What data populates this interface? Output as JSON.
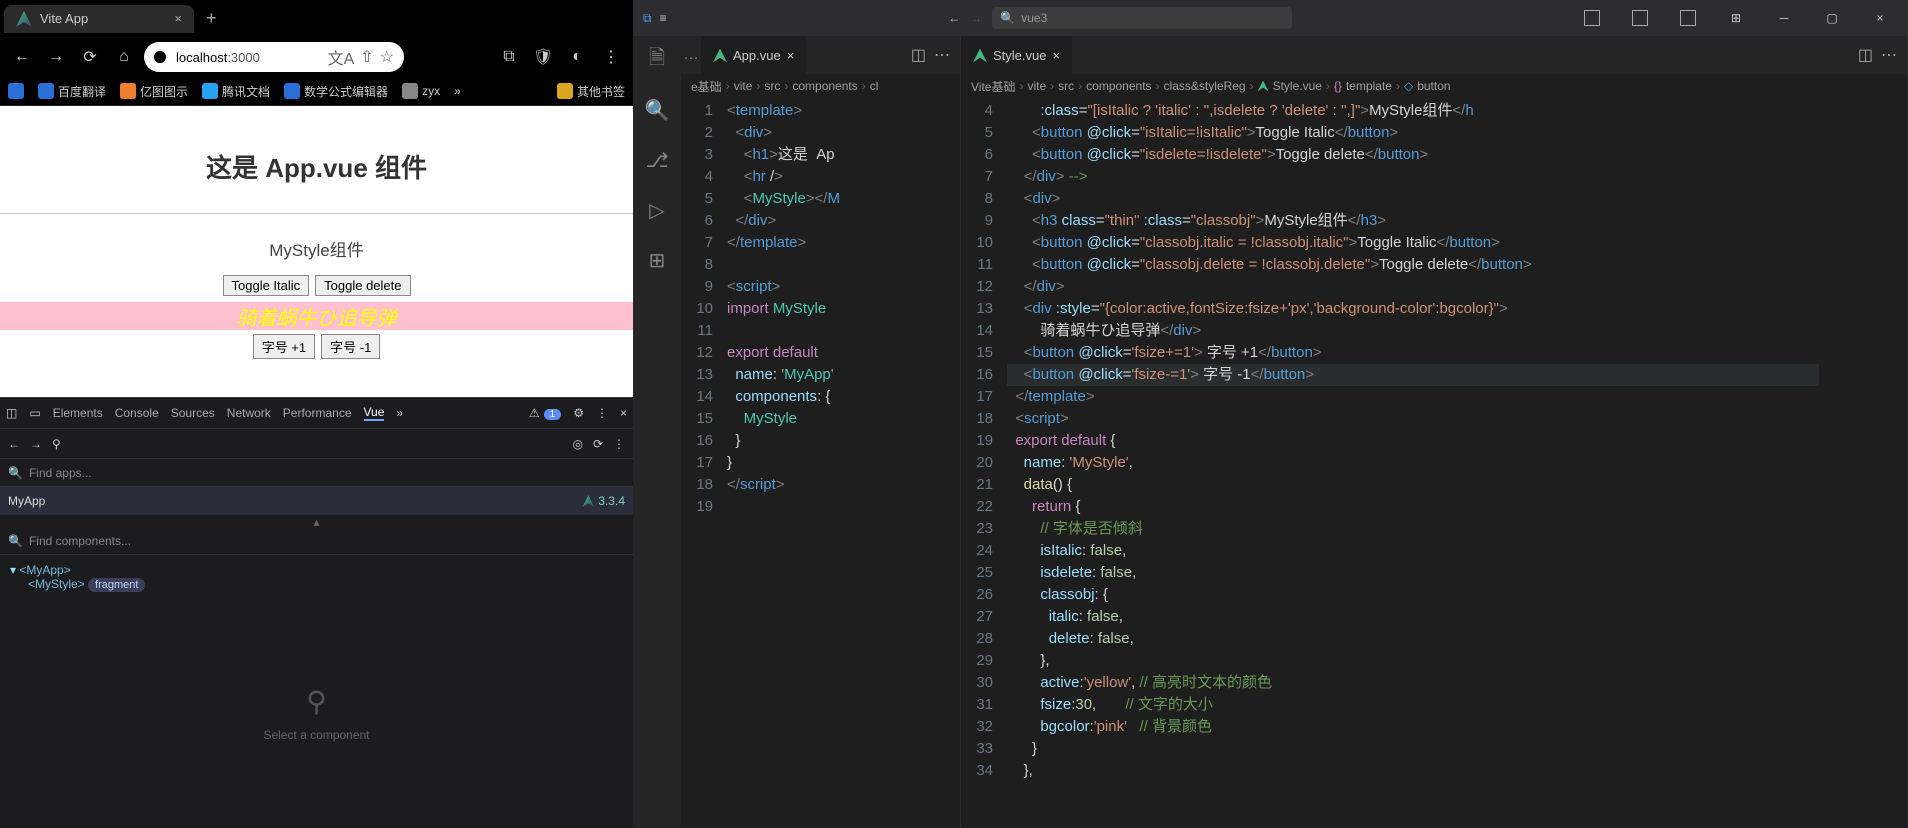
{
  "browser": {
    "tab_title": "Vite App",
    "url_host": "localhost",
    "url_port": ":3000",
    "bookmarks": [
      {
        "label": "百度翻译",
        "color": "#2a6fd6"
      },
      {
        "label": "亿图图示",
        "color": "#f08030"
      },
      {
        "label": "腾讯文档",
        "color": "#2aa0f0"
      },
      {
        "label": "数学公式编辑器",
        "color": "#2a6fd6"
      },
      {
        "label": "zyx",
        "color": "#888"
      },
      {
        "label": "»",
        "color": "transparent"
      },
      {
        "label": "其他书签",
        "color": "#d9a520"
      }
    ]
  },
  "page_content": {
    "h1": "这是 App.vue 组件",
    "subtitle": "MyStyle组件",
    "buttons_row1": [
      "Toggle Italic",
      "Toggle delete"
    ],
    "pink_text": "骑着蜗牛ひ追导弹",
    "buttons_row2": [
      "字号 +1",
      "字号 -1"
    ]
  },
  "devtools": {
    "tabs": [
      "Elements",
      "Console",
      "Sources",
      "Network",
      "Performance",
      "Vue"
    ],
    "active_tab": "Vue",
    "warn_count": "1",
    "search1": "Find apps...",
    "app_row": "MyApp",
    "vue_version": "3.3.4",
    "search2": "Find components...",
    "tree": {
      "root": "<MyApp>",
      "child": "<MyStyle>",
      "frag": "fragment"
    },
    "placeholder": "Select a component"
  },
  "vscode": {
    "command_center": "vue3",
    "tabs_left": {
      "name": "App.vue"
    },
    "tabs_right": {
      "name": "Style.vue"
    },
    "breadcrumb_left": [
      "e基础",
      "vite",
      "src",
      "components",
      "cl"
    ],
    "breadcrumb_right": [
      "Vite基础",
      "vite",
      "src",
      "components",
      "class&styleReg",
      "Style.vue",
      "template",
      "button"
    ],
    "gutter_left": [
      "1",
      "2",
      "3",
      "4",
      "5",
      "6",
      "7",
      "8",
      "9",
      "10",
      "11",
      "12",
      "13",
      "14",
      "15",
      "16",
      "17",
      "18",
      "19"
    ],
    "gutter_right": [
      "4",
      "5",
      "6",
      "7",
      "8",
      "9",
      "10",
      "11",
      "12",
      "13",
      "14",
      "15",
      "16",
      "17",
      "18",
      "19",
      "20",
      "21",
      "22",
      "23",
      "24",
      "25",
      "26",
      "27",
      "28",
      "29",
      "30",
      "31",
      "32",
      "33",
      "34"
    ],
    "code_left": [
      "<template>",
      "  <div>",
      "    <h1>这是  Ap",
      "    <hr />",
      "    <MyStyle></M",
      "  </div>",
      "</template>",
      "",
      "<script>",
      "import MyStyle ",
      "",
      "export default ",
      "  name: 'MyApp'",
      "  components: {",
      "    MyStyle",
      "  }",
      "}",
      "</script>",
      ""
    ],
    "code_right_raw": [
      {
        "indent": 8,
        "html": "<span class='t-attr'>:class</span>=<span class='t-str'>\"[isItalic ? 'italic' : '',isdelete ? 'delete' : '',]\"</span><span class='t-tag'>&gt;</span>MyStyle组件<span class='t-tag'>&lt;/</span><span class='t-name'>h</span>"
      },
      {
        "indent": 6,
        "html": "<span class='t-tag'>&lt;</span><span class='t-name'>button</span> <span class='t-attr'>@click</span>=<span class='t-str'>\"isItalic=!isItalic\"</span><span class='t-tag'>&gt;</span>Toggle Italic<span class='t-tag'>&lt;/</span><span class='t-name'>button</span><span class='t-tag'>&gt;</span>"
      },
      {
        "indent": 6,
        "html": "<span class='t-tag'>&lt;</span><span class='t-name'>button</span> <span class='t-attr'>@click</span>=<span class='t-str'>\"isdelete=!isdelete\"</span><span class='t-tag'>&gt;</span>Toggle delete<span class='t-tag'>&lt;/</span><span class='t-name'>button</span><span class='t-tag'>&gt;</span>"
      },
      {
        "indent": 4,
        "html": "<span class='t-tag'>&lt;/</span><span class='t-name'>div</span><span class='t-tag'>&gt;</span> <span class='t-cm'>--&gt;</span>"
      },
      {
        "indent": 4,
        "html": "<span class='t-tag'>&lt;</span><span class='t-name'>div</span><span class='t-tag'>&gt;</span>"
      },
      {
        "indent": 6,
        "html": "<span class='t-tag'>&lt;</span><span class='t-name'>h3</span> <span class='t-attr'>class</span>=<span class='t-str'>\"thin\"</span> <span class='t-attr'>:class</span>=<span class='t-str'>\"classobj\"</span><span class='t-tag'>&gt;</span>MyStyle组件<span class='t-tag'>&lt;/</span><span class='t-name'>h3</span><span class='t-tag'>&gt;</span>"
      },
      {
        "indent": 6,
        "html": "<span class='t-tag'>&lt;</span><span class='t-name'>button</span> <span class='t-attr'>@click</span>=<span class='t-str'>\"classobj.italic = !classobj.italic\"</span><span class='t-tag'>&gt;</span>Toggle Italic<span class='t-tag'>&lt;/</span><span class='t-name'>button</span><span class='t-tag'>&gt;</span>"
      },
      {
        "indent": 6,
        "html": "<span class='t-tag'>&lt;</span><span class='t-name'>button</span> <span class='t-attr'>@click</span>=<span class='t-str'>\"classobj.delete = !classobj.delete\"</span><span class='t-tag'>&gt;</span>Toggle delete<span class='t-tag'>&lt;/</span><span class='t-name'>button</span><span class='t-tag'>&gt;</span>"
      },
      {
        "indent": 4,
        "html": "<span class='t-tag'>&lt;/</span><span class='t-name'>div</span><span class='t-tag'>&gt;</span>"
      },
      {
        "indent": 4,
        "html": "<span class='t-tag'>&lt;</span><span class='t-name'>div</span> <span class='t-attr'>:style</span>=<span class='t-str'>\"{color:active,fontSize:fsize+'px','background-color':bgcolor}\"</span><span class='t-tag'>&gt;</span>"
      },
      {
        "indent": 8,
        "html": "骑着蜗牛ひ追导弹<span class='t-tag'>&lt;/</span><span class='t-name'>div</span><span class='t-tag'>&gt;</span>"
      },
      {
        "indent": 4,
        "html": "<span class='t-tag'>&lt;</span><span class='t-name'>button</span> <span class='t-attr'>@click</span>=<span class='t-str'>'fsize+=1'</span><span class='t-tag'>&gt;</span> 字号 +1<span class='t-tag'>&lt;/</span><span class='t-name'>button</span><span class='t-tag'>&gt;</span>"
      },
      {
        "indent": 4,
        "html": "<span class='t-tag'>&lt;</span><span class='t-name'>button</span> <span class='t-attr'>@click</span>=<span class='t-str'>'fsize-=1'</span><span class='t-tag'>&gt;</span> 字号 -1<span class='t-tag'>&lt;/</span><span class='t-name'>button</span><span class='t-tag'>&gt;</span>",
        "hl": true
      },
      {
        "indent": 2,
        "html": "<span class='t-tag'>&lt;/</span><span class='t-name'>template</span><span class='t-tag'>&gt;</span>"
      },
      {
        "indent": 2,
        "html": "<span class='t-tag'>&lt;</span><span class='t-name'>script</span><span class='t-tag'>&gt;</span>"
      },
      {
        "indent": 2,
        "html": "<span class='t-kw'>export</span> <span class='t-kw'>default</span> {"
      },
      {
        "indent": 4,
        "html": "<span class='t-prop'>name</span>: <span class='t-str'>'MyStyle'</span>,"
      },
      {
        "indent": 4,
        "html": "<span class='t-fun'>data</span>() {"
      },
      {
        "indent": 6,
        "html": "<span class='t-kw'>return</span> {"
      },
      {
        "indent": 8,
        "html": "<span class='t-cm'>// 字体是否倾斜</span>"
      },
      {
        "indent": 8,
        "html": "<span class='t-prop'>isItalic</span>: <span class='t-num'>false</span>,"
      },
      {
        "indent": 8,
        "html": "<span class='t-prop'>isdelete</span>: <span class='t-num'>false</span>,"
      },
      {
        "indent": 8,
        "html": "<span class='t-prop'>classobj</span>: {"
      },
      {
        "indent": 10,
        "html": "<span class='t-prop'>italic</span>: <span class='t-num'>false</span>,"
      },
      {
        "indent": 10,
        "html": "<span class='t-prop'>delete</span>: <span class='t-num'>false</span>,"
      },
      {
        "indent": 8,
        "html": "},"
      },
      {
        "indent": 8,
        "html": "<span class='t-prop'>active</span>:<span class='t-str'>'yellow'</span>, <span class='t-cm'>// 高亮时文本的颜色</span>"
      },
      {
        "indent": 8,
        "html": "<span class='t-prop'>fsize</span>:<span class='t-num'>30</span>,       <span class='t-cm'>// 文字的大小</span>"
      },
      {
        "indent": 8,
        "html": "<span class='t-prop'>bgcolor</span>:<span class='t-str'>'pink'</span>   <span class='t-cm'>// 背景颜色</span>"
      },
      {
        "indent": 6,
        "html": "}"
      },
      {
        "indent": 4,
        "html": "},"
      }
    ]
  }
}
